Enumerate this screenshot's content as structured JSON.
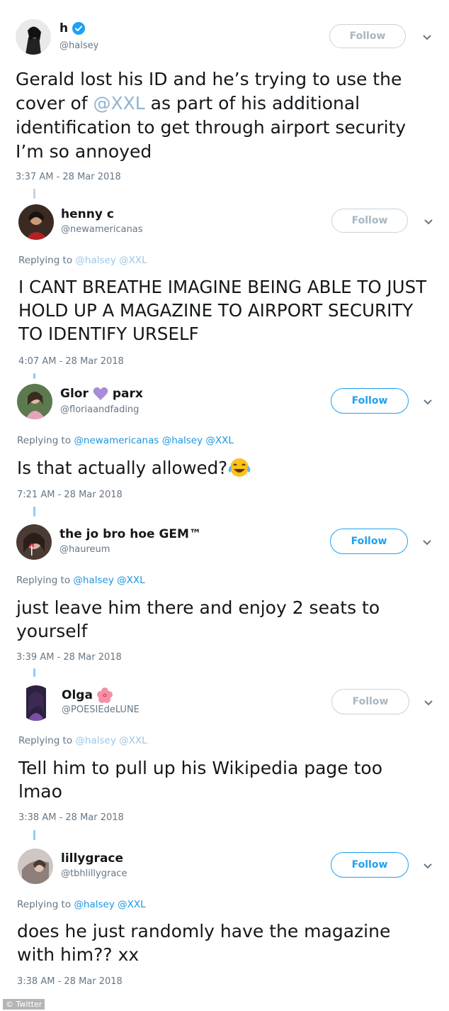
{
  "main_tweet": {
    "name": "h",
    "handle": "@halsey",
    "follow_label": "Follow",
    "text_before": "Gerald lost his ID and he’s trying to use the cover of ",
    "mention": "@XXL",
    "text_after": " as part of his additional identification to get through airport security I’m so annoyed",
    "timestamp": "3:37 AM - 28 Mar 2018"
  },
  "replies": [
    {
      "name": "henny c",
      "handle": "@newamericanas",
      "follow_label": "Follow",
      "replying_prefix": "Replying to",
      "mentions": "@halsey @XXL",
      "text": "I CANT BREATHE IMAGINE BEING ABLE TO JUST HOLD UP A MAGAZINE TO AIRPORT SECURITY TO IDENTIFY URSELF",
      "timestamp": "4:07 AM - 28 Mar 2018"
    },
    {
      "name_part1": "Glor",
      "name_emoji": "purple-heart-emoji",
      "name_part2": "parx",
      "handle": "@floriaandfading",
      "follow_label": "Follow",
      "replying_prefix": "Replying to",
      "mentions": "@newamericanas @halsey @XXL",
      "text": "Is that actually allowed?",
      "text_emoji": "tears-of-joy-emoji",
      "timestamp": "7:21 AM - 28 Mar 2018"
    },
    {
      "name": "the jo bro hoe GEM™",
      "handle": "@haureum",
      "follow_label": "Follow",
      "replying_prefix": "Replying to",
      "mentions": "@halsey @XXL",
      "text": "just leave him there and enjoy 2 seats to yourself",
      "timestamp": "3:39 AM - 28 Mar 2018"
    },
    {
      "name": "Olga",
      "name_emoji": "hibiscus-emoji",
      "handle": "@POESIEdeLUNE",
      "follow_label": "Follow",
      "replying_prefix": "Replying to",
      "mentions": "@halsey @XXL",
      "text": "Tell him to pull up his Wikipedia page too lmao",
      "timestamp": "3:38 AM - 28 Mar 2018"
    },
    {
      "name": "lillygrace",
      "handle": "@tbhlillygrace",
      "follow_label": "Follow",
      "replying_prefix": "Replying to",
      "mentions": "@halsey @XXL",
      "text": "does he just randomly have the magazine with him?? xx",
      "timestamp": "3:38 AM - 28 Mar 2018"
    }
  ],
  "credit": "© Twitter"
}
